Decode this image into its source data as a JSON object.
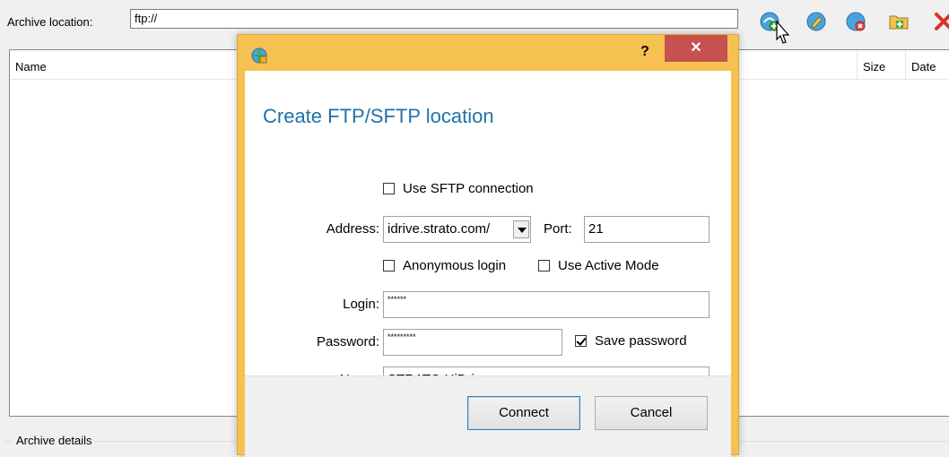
{
  "background": {
    "location_label": "Archive location:",
    "location_value": "ftp://",
    "toolbar": {
      "icons": [
        "connect-ftp-icon",
        "edit-location-icon",
        "remove-location-icon",
        "new-folder-icon",
        "delete-icon"
      ]
    },
    "columns": [
      "Name",
      "Size",
      "Date"
    ],
    "details_label": "Archive details"
  },
  "dialog": {
    "help": "?",
    "close": "✕",
    "heading": "Create FTP/SFTP location",
    "use_sftp": {
      "label": "Use SFTP connection",
      "checked": false
    },
    "address": {
      "label": "Address:",
      "value": "idrive.strato.com/"
    },
    "port": {
      "label": "Port:",
      "value": "21"
    },
    "anonymous_login": {
      "label": "Anonymous login",
      "checked": false
    },
    "active_mode": {
      "label": "Use Active Mode",
      "checked": false
    },
    "login": {
      "label": "Login:",
      "value": "******"
    },
    "password": {
      "label": "Password:",
      "value": "*********"
    },
    "save_password": {
      "label": "Save password",
      "checked": true
    },
    "name": {
      "label": "Name:",
      "value": "STRATO HiDrive"
    },
    "buttons": {
      "connect": "Connect",
      "cancel": "Cancel"
    }
  },
  "colors": {
    "dialog_frame": "#f5c252",
    "close_button": "#c75050",
    "heading": "#1e73a8"
  }
}
